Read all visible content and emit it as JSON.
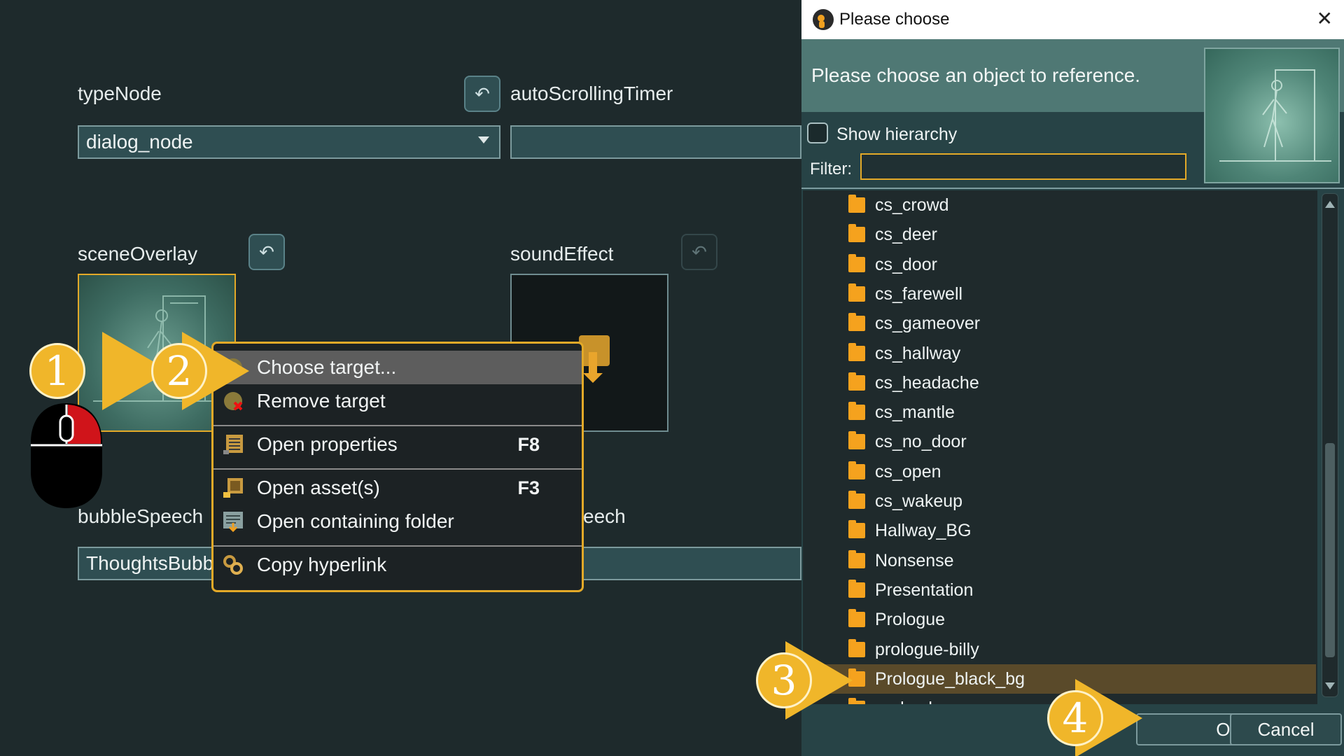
{
  "panel": {
    "type_node_label": "typeNode",
    "type_node_value": "dialog_node",
    "auto_scrolling_label": "autoScrollingTimer",
    "scene_overlay_label": "sceneOverlay",
    "sound_effect_label": "soundEffect",
    "bubble_speech_label": "bubbleSpeech",
    "bubble_speech_value": "ThoughtsBubb",
    "right_label_partial": "eech"
  },
  "context_menu": {
    "items": [
      {
        "label": "Choose target...",
        "shortcut": ""
      },
      {
        "label": "Remove target",
        "shortcut": ""
      },
      {
        "label": "Open properties",
        "shortcut": "F8"
      },
      {
        "label": "Open asset(s)",
        "shortcut": "F3"
      },
      {
        "label": "Open containing folder",
        "shortcut": ""
      },
      {
        "label": "Copy hyperlink",
        "shortcut": ""
      }
    ]
  },
  "dialog": {
    "title": "Please choose",
    "close_glyph": "✕",
    "header_text": "Please choose an object to reference.",
    "show_hierarchy_label": "Show hierarchy",
    "filter_label": "Filter:",
    "filter_value": "",
    "items": [
      "cs_crowd",
      "cs_deer",
      "cs_door",
      "cs_farewell",
      "cs_gameover",
      "cs_hallway",
      "cs_headache",
      "cs_mantle",
      "cs_no_door",
      "cs_open",
      "cs_wakeup",
      "Hallway_BG",
      "Nonsense",
      "Presentation",
      "Prologue",
      "prologue-billy",
      "Prologue_black_bg",
      "realm_bg"
    ],
    "selected_item": "Prologue_black_bg",
    "ok_label": "OK",
    "cancel_label": "Cancel"
  },
  "markers": [
    "1",
    "2",
    "3",
    "4"
  ],
  "colors": {
    "accent": "#e3a928",
    "marker": "#f0b62a",
    "dialog_bg": "#274346",
    "header_bg": "#4f7874",
    "folder": "#f5a21e",
    "mouse_button": "#d0141a"
  }
}
